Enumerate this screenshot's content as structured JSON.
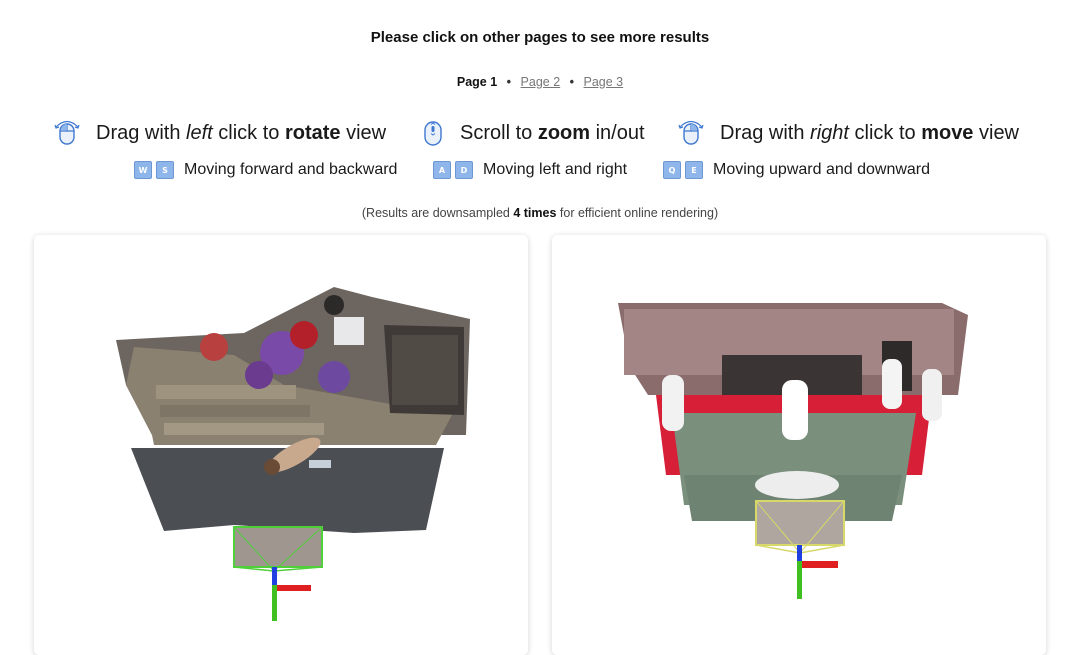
{
  "header": {
    "instruction": "Please click on other pages to see more results"
  },
  "pagination": {
    "current": "Page 1",
    "separator": "•",
    "links": [
      "Page 2",
      "Page 3"
    ]
  },
  "controls": {
    "rotate": {
      "icon": "mouse-left-drag-icon",
      "pre": "Drag with ",
      "em": "left",
      "mid": " click to ",
      "strong": "rotate",
      "post": " view"
    },
    "zoom": {
      "icon": "mouse-scroll-icon",
      "pre": "Scroll to ",
      "strong": "zoom",
      "post": " in/out"
    },
    "move": {
      "icon": "mouse-right-drag-icon",
      "pre": "Drag with ",
      "em": "right",
      "mid": " click to ",
      "strong": "move",
      "post": " view"
    }
  },
  "keys": {
    "forward_back": {
      "keys": [
        "W",
        "S"
      ],
      "label": "Moving forward and backward"
    },
    "left_right": {
      "keys": [
        "A",
        "D"
      ],
      "label": "Moving left and right"
    },
    "up_down": {
      "keys": [
        "Q",
        "E"
      ],
      "label": "Moving upward and downward"
    }
  },
  "note": {
    "pre": "(Results are downsampled ",
    "strong": "4 times",
    "post": " for efficient online rendering)"
  },
  "colors": {
    "key_fill": "#8fb6ea",
    "icon_blue": "#3f78d0",
    "link_gray": "#777777",
    "axis_x": "#e02020",
    "axis_y": "#40c020",
    "axis_z": "#2040e0"
  },
  "viewers": [
    {
      "name": "scene-viewer-courtyard"
    },
    {
      "name": "scene-viewer-dojo"
    }
  ]
}
